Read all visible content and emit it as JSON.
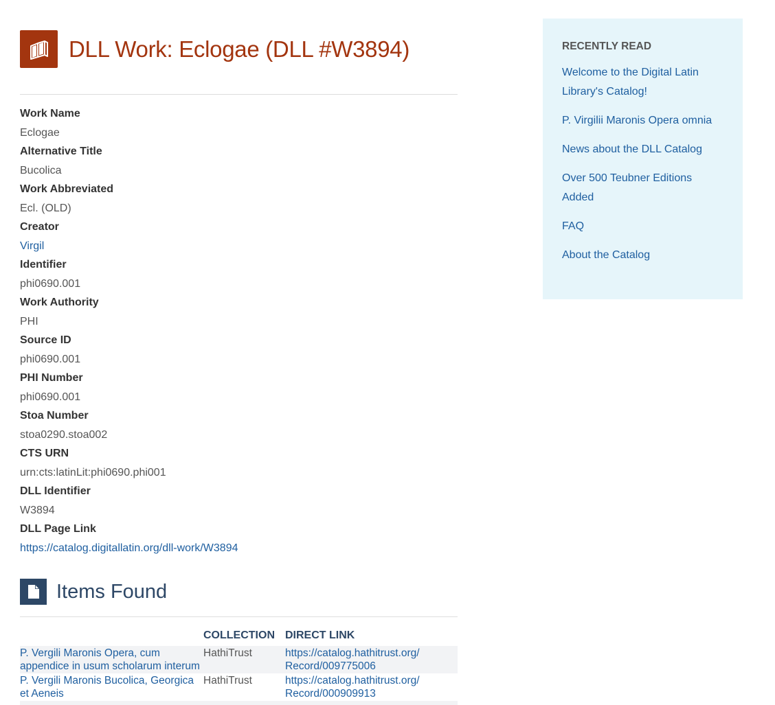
{
  "page": {
    "title": "DLL Work: Eclogae (DLL #W3894)",
    "title_color": "#a3350f"
  },
  "fields": [
    {
      "label": "Work Name",
      "value": "Eclogae"
    },
    {
      "label": "Alternative Title",
      "value": "Bucolica"
    },
    {
      "label": "Work Abbreviated",
      "value": "Ecl. (OLD)"
    },
    {
      "label": "Creator",
      "value": "Virgil"
    },
    {
      "label": "Identifier",
      "value": "phi0690.001"
    },
    {
      "label": "Work Authority",
      "value": "PHI"
    },
    {
      "label": "Source ID",
      "value": "phi0690.001"
    },
    {
      "label": "PHI Number",
      "value": "phi0690.001"
    },
    {
      "label": "Stoa Number",
      "value": "stoa0290.stoa002"
    },
    {
      "label": "CTS URN",
      "value": "urn:cts:latinLit:phi0690.phi001"
    },
    {
      "label": "DLL Identifier",
      "value": "W3894"
    },
    {
      "label": "DLL Page Link",
      "value": "https://catalog.digitallatin.org/dll-work/W3894"
    }
  ],
  "items_section": {
    "title": "Items Found",
    "columns": [
      "",
      "COLLECTION",
      "DIRECT LINK"
    ],
    "rows": [
      {
        "title_line1": "P. Vergili Maronis Opera, cum",
        "title_line2": "appendice in usum scholarum interum",
        "collection": "HathiTrust",
        "link_line1": "https://catalog.hathitrust.org/",
        "link_line2": "Record/009775006"
      },
      {
        "title_line1": "P. Vergili Maronis Bucolica, Georgica",
        "title_line2": "et Aeneis",
        "collection": "HathiTrust",
        "link_line1": "https://catalog.hathitrust.org/",
        "link_line2": "Record/000909913"
      }
    ]
  },
  "sidebar": {
    "title": "RECENTLY READ",
    "links": [
      "Welcome to the Digital Latin Library's Catalog!",
      "P. Virgilii Maronis Opera omnia",
      "News about the DLL Catalog",
      "Over 500 Teubner Editions Added",
      "FAQ",
      "About the Catalog"
    ]
  },
  "icons": {
    "title_icon": "books-icon",
    "items_icon": "document-icon"
  },
  "colors": {
    "accent_brown": "#a3350f",
    "accent_navy": "#2d4766",
    "link_blue": "#1f5fa0",
    "sidebar_bg": "#e6f5fa"
  }
}
